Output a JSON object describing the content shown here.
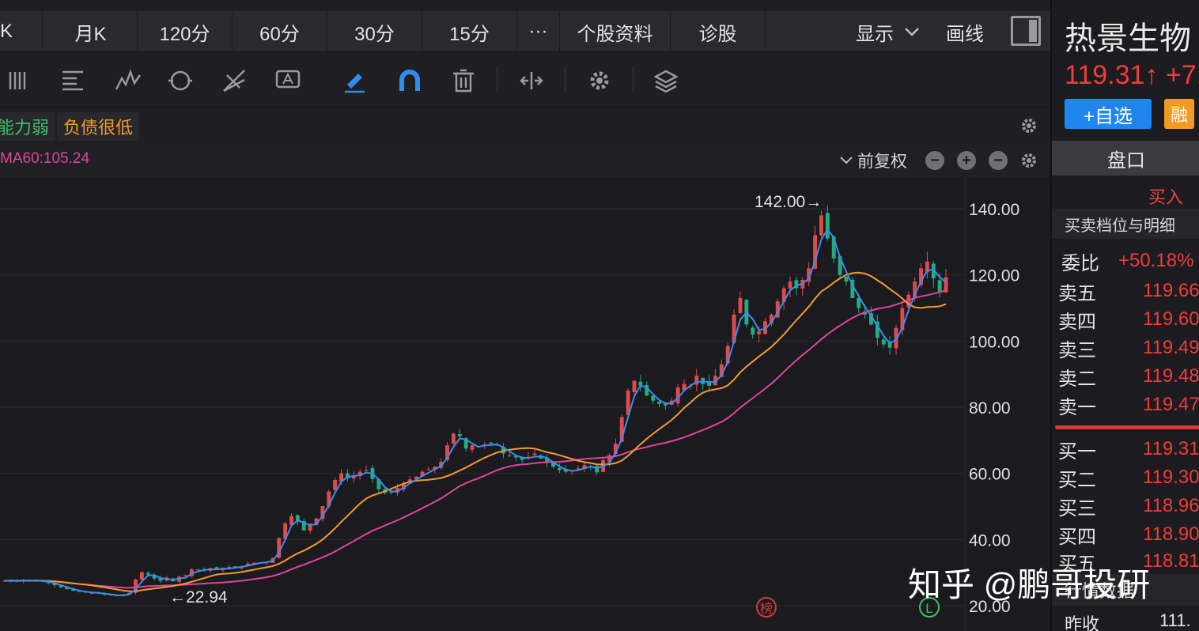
{
  "tabs": [
    {
      "label": "K"
    },
    {
      "label": "月K"
    },
    {
      "label": "120分"
    },
    {
      "label": "60分"
    },
    {
      "label": "30分"
    },
    {
      "label": "15分"
    },
    {
      "label": "···"
    },
    {
      "label": "个股资料"
    },
    {
      "label": "诊股"
    }
  ],
  "header_right": {
    "display_label": "显示",
    "draw_label": "画线"
  },
  "toolbar_icons": [
    "columns-icon",
    "list-icon",
    "zigzag-icon",
    "cycle-icon",
    "fan-icon",
    "text-icon",
    "pen-icon",
    "magnet-icon",
    "trash-icon",
    "range-icon",
    "settings-icon",
    "layers-icon"
  ],
  "tags": [
    {
      "text": "能力弱",
      "color": "#3fbf68"
    },
    {
      "text": "负债很低",
      "color": "#f29a2e"
    }
  ],
  "ma_label": "MA60:105.24",
  "adjust_label": "前复权",
  "markers": {
    "rank": "榜",
    "l": "L"
  },
  "chart_data": {
    "type": "candlestick",
    "y_axis": {
      "min": 20,
      "max": 140,
      "ticks": [
        "140.00",
        "120.00",
        "100.00",
        "80.00",
        "60.00",
        "40.00",
        "20.00"
      ]
    },
    "annotations": {
      "high": "142.00→",
      "low": "←22.94"
    },
    "colors": {
      "up": "#e04a4a",
      "down": "#1fae7f",
      "ma_short": "#3d8cf0",
      "ma_mid": "#f29a2e",
      "ma_long": "#e0449a"
    },
    "close": [
      27.5,
      27.7,
      27.4,
      27.8,
      27.6,
      27.5,
      27.3,
      27.0,
      26.2,
      25.6,
      25.0,
      24.5,
      24.2,
      24.0,
      23.8,
      23.8,
      23.4,
      23.1,
      23.1,
      23.2,
      23.9,
      27.9,
      30.1,
      29.4,
      28.2,
      27.5,
      28.5,
      27.4,
      28.8,
      29.2,
      31.0,
      30.9,
      30.6,
      31.4,
      30.9,
      31.1,
      31.7,
      31.6,
      31.9,
      32.7,
      33.0,
      33.1,
      33.2,
      34.4,
      40.5,
      44.9,
      47.1,
      45.4,
      42.8,
      44.8,
      46.4,
      50.1,
      54.5,
      58.0,
      60.0,
      58.5,
      59.3,
      60.5,
      61.0,
      58.3,
      55.2,
      54.1,
      54.2,
      55.6,
      57.1,
      58.2,
      59.0,
      60.5,
      61.2,
      62.0,
      63.5,
      68.5,
      72.0,
      71.2,
      67.5,
      68.5,
      68.0,
      68.8,
      69.0,
      68.5,
      66.0,
      65.5,
      64.8,
      64.1,
      65.0,
      66.0,
      64.5,
      63.5,
      62.0,
      61.0,
      60.5,
      60.8,
      61.5,
      62.5,
      62.0,
      60.3,
      64.0,
      65.5,
      69.0,
      77.0,
      85.0,
      88.0,
      86.5,
      83.5,
      82.0,
      81.0,
      80.5,
      82.0,
      86.0,
      87.0,
      86.5,
      89.5,
      87.0,
      86.5,
      89.5,
      93.0,
      98.5,
      108.0,
      113.0,
      105.0,
      102.0,
      103.0,
      106.0,
      108.0,
      112.0,
      116.0,
      118.0,
      116.0,
      118.5,
      122.0,
      132.0,
      138.0,
      131.0,
      125.0,
      120.0,
      118.0,
      113.0,
      110.0,
      108.0,
      105.0,
      101.0,
      99.0,
      98.0,
      104.0,
      110.0,
      114.0,
      118.0,
      122.0,
      124.0,
      119.0,
      115.0,
      119.31
    ]
  },
  "panel": {
    "stock_name": "热景生物",
    "price": "119.31↑ +7.",
    "add_fav": "+自选",
    "rong": "融",
    "pankou_tab": "盘口",
    "buy_label": "买入",
    "detail_title": "买卖档位与明细",
    "ratio_label": "委比",
    "ratio_value": "+50.18%",
    "asks": [
      {
        "label": "卖五",
        "price": "119.66"
      },
      {
        "label": "卖四",
        "price": "119.60"
      },
      {
        "label": "卖三",
        "price": "119.49"
      },
      {
        "label": "卖二",
        "price": "119.48"
      },
      {
        "label": "卖一",
        "price": "119.47"
      }
    ],
    "bids": [
      {
        "label": "买一",
        "price": "119.31"
      },
      {
        "label": "买二",
        "price": "119.30"
      },
      {
        "label": "买三",
        "price": "118.96"
      },
      {
        "label": "买四",
        "price": "118.90"
      },
      {
        "label": "买五",
        "price": "118.81"
      }
    ],
    "quote_title": "行情数据",
    "prev_close_label": "昨收",
    "prev_close_value": "111."
  },
  "watermark": "知乎 @鹏哥投研"
}
